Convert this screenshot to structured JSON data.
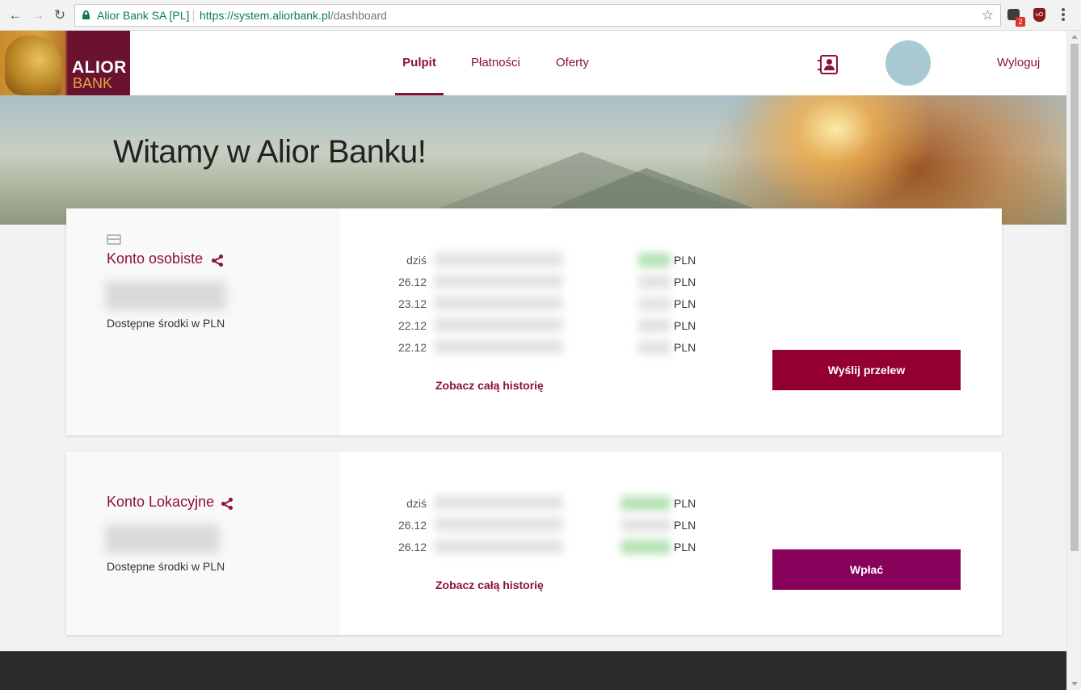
{
  "browser": {
    "site_name": "Alior Bank SA [PL]",
    "url_host": "https://system.aliorbank.pl",
    "url_path": "/dashboard",
    "extension_badge": "2",
    "ublock_label": "uO",
    "back_glyph": "←",
    "forward_glyph": "→",
    "reload_glyph": "↻",
    "star_glyph": "☆"
  },
  "header": {
    "logo_line1": "ALIOR",
    "logo_line2": "BANK",
    "nav": {
      "pulpit": "Pulpit",
      "platnosci": "Płatności",
      "oferty": "Oferty"
    },
    "logout": "Wyloguj"
  },
  "hero": {
    "title": "Witamy w Alior Banku!"
  },
  "accounts": [
    {
      "name": "Konto osobiste",
      "available_label": "Dostępne środki w PLN",
      "transactions": [
        {
          "date": "dziś",
          "currency": "PLN"
        },
        {
          "date": "26.12",
          "currency": "PLN"
        },
        {
          "date": "23.12",
          "currency": "PLN"
        },
        {
          "date": "22.12",
          "currency": "PLN"
        },
        {
          "date": "22.12",
          "currency": "PLN"
        }
      ],
      "history_link": "Zobacz całą historię",
      "action_button": "Wyślij przelew"
    },
    {
      "name": "Konto Lokacyjne",
      "available_label": "Dostępne środki w PLN",
      "transactions": [
        {
          "date": "dziś",
          "currency": "PLN"
        },
        {
          "date": "26.12",
          "currency": "PLN"
        },
        {
          "date": "26.12",
          "currency": "PLN"
        }
      ],
      "history_link": "Zobacz całą historię",
      "action_button": "Wpłać"
    }
  ],
  "colors": {
    "brand": "#8b1239",
    "send_button": "#93002f",
    "pay_button": "#87005a",
    "secure_green": "#0b8043",
    "footer": "#2b2b2b"
  }
}
